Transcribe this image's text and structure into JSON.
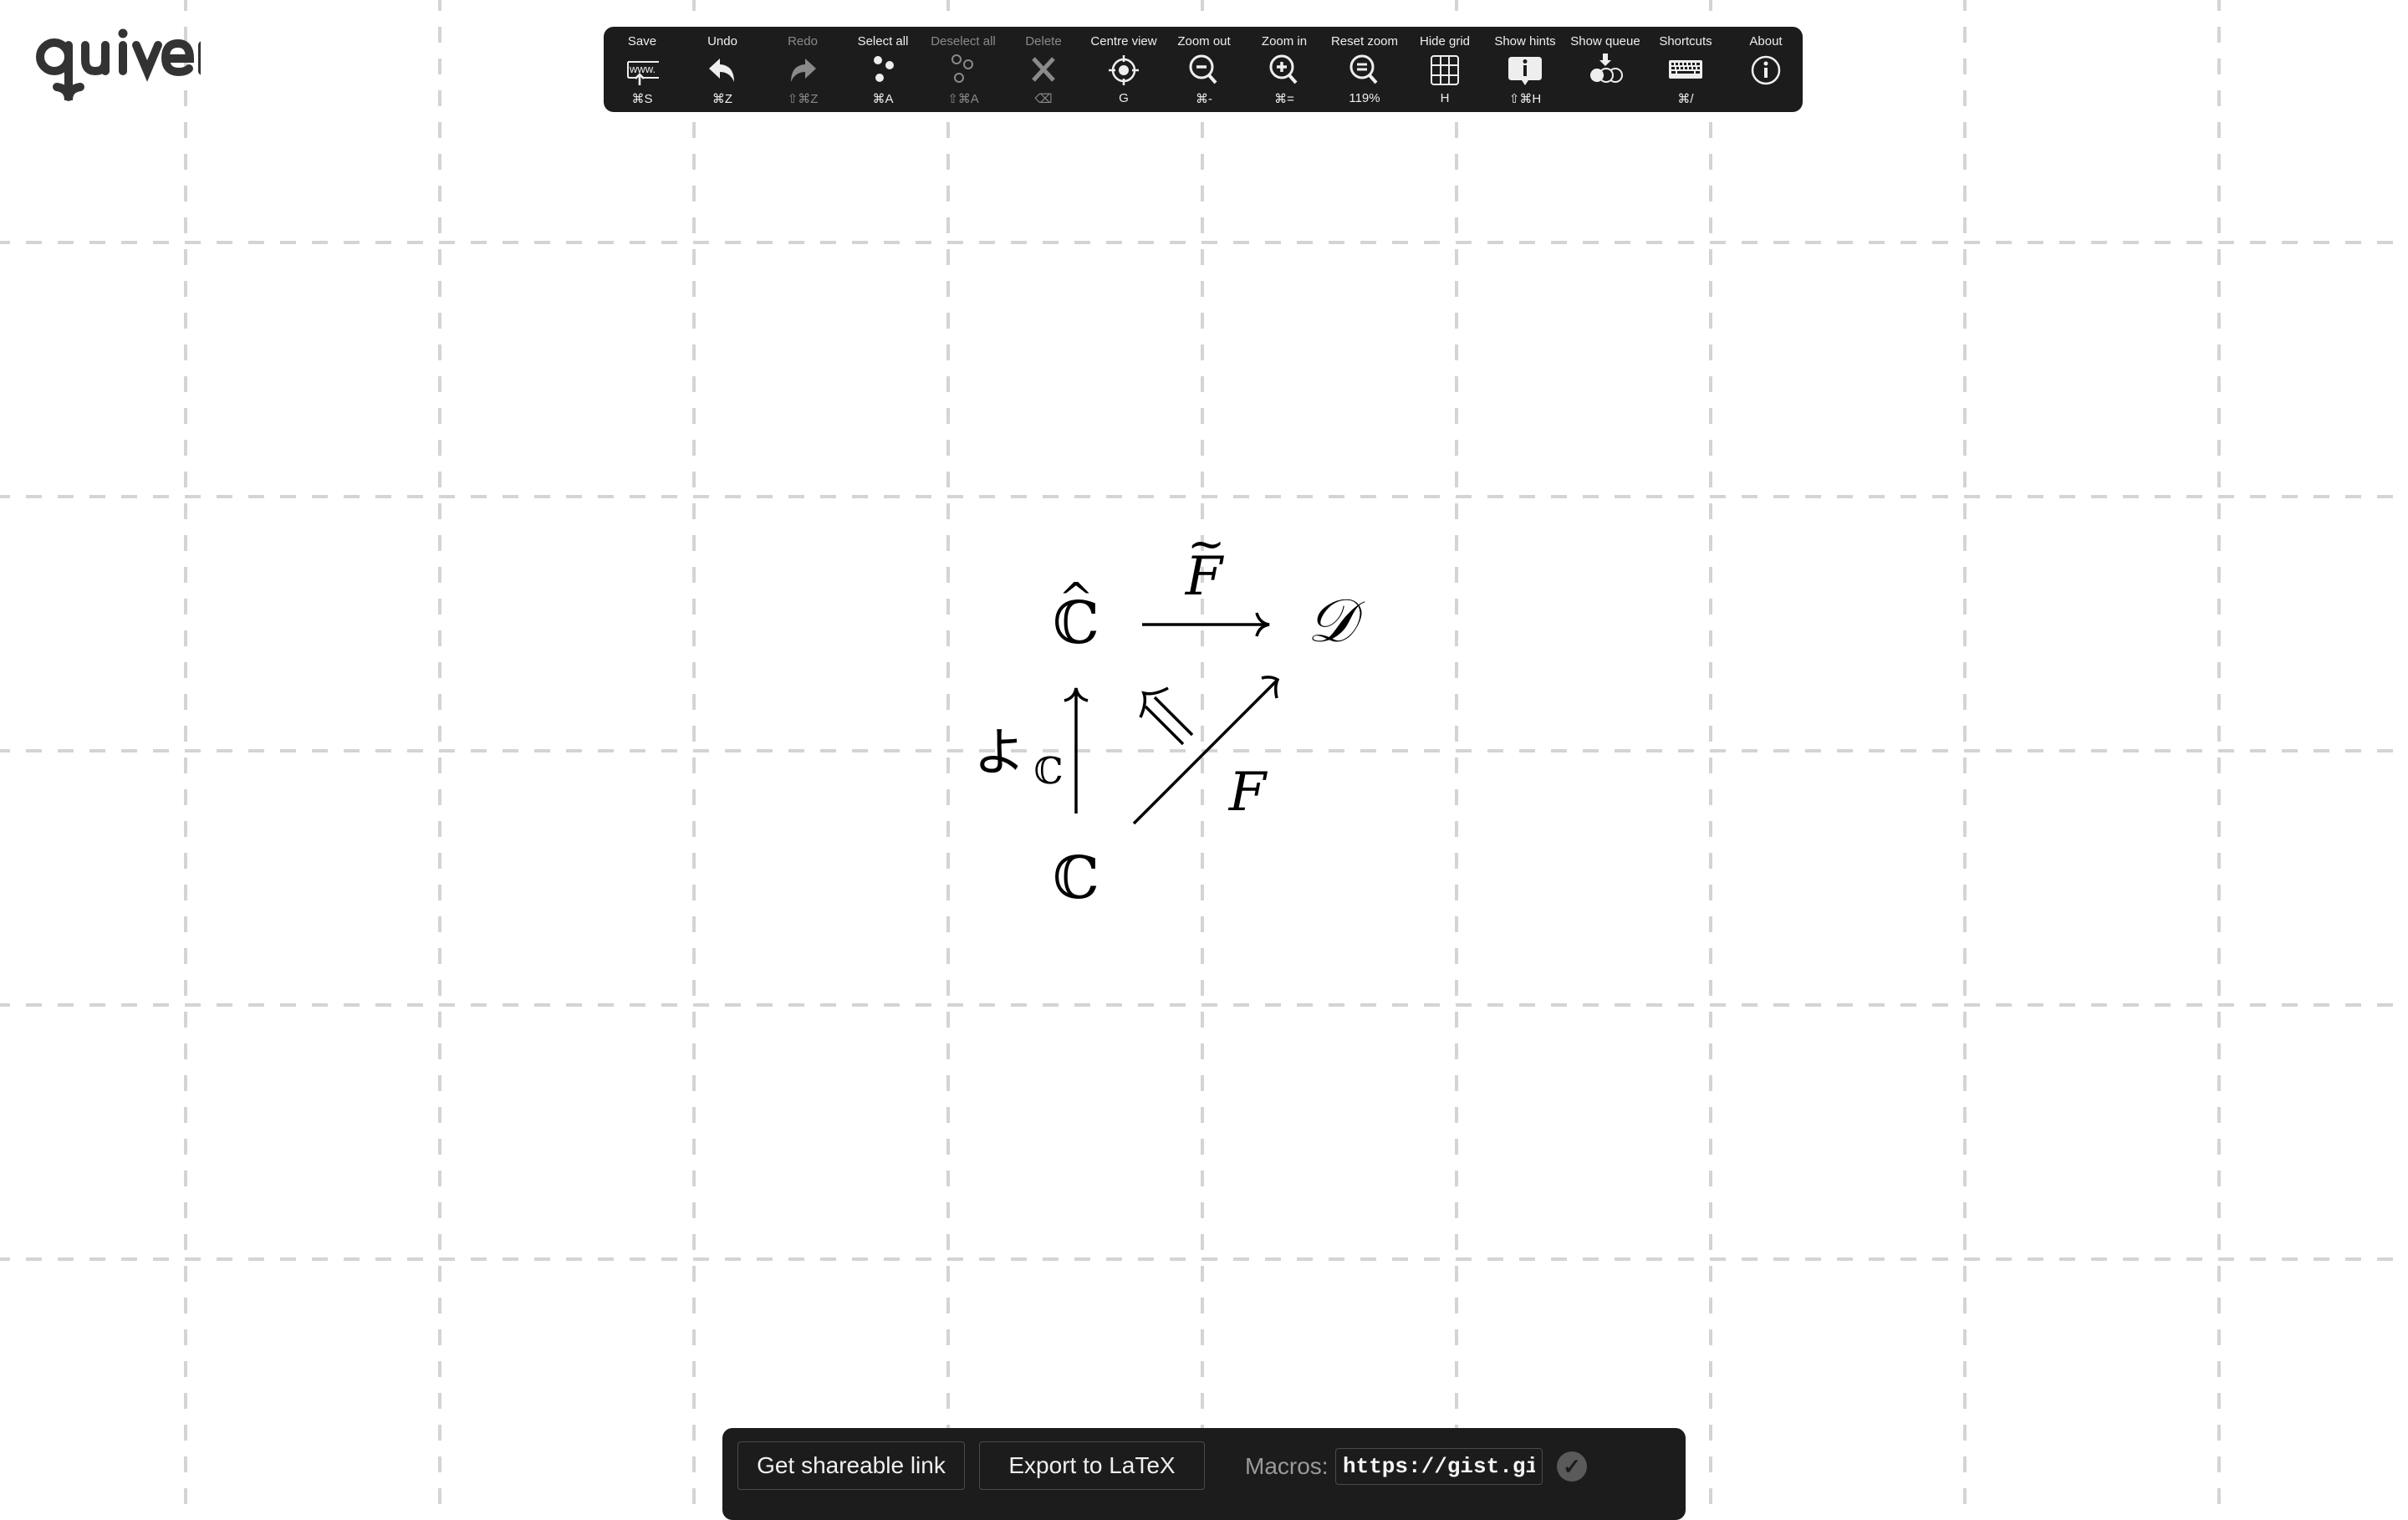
{
  "app": {
    "logo_text": "quiver"
  },
  "toolbar": {
    "items": [
      {
        "label": "Save",
        "shortcut": "⌘S",
        "icon": "save-url-icon",
        "enabled": true
      },
      {
        "label": "Undo",
        "shortcut": "⌘Z",
        "icon": "undo-icon",
        "enabled": true
      },
      {
        "label": "Redo",
        "shortcut": "⇧⌘Z",
        "icon": "redo-icon",
        "enabled": false
      },
      {
        "label": "Select all",
        "shortcut": "⌘A",
        "icon": "select-all-icon",
        "enabled": true
      },
      {
        "label": "Deselect all",
        "shortcut": "⇧⌘A",
        "icon": "deselect-all-icon",
        "enabled": false
      },
      {
        "label": "Delete",
        "shortcut": "⌫",
        "icon": "delete-icon",
        "enabled": false
      },
      {
        "label": "Centre view",
        "shortcut": "G",
        "icon": "centre-view-icon",
        "enabled": true
      },
      {
        "label": "Zoom out",
        "shortcut": "⌘-",
        "icon": "zoom-out-icon",
        "enabled": true
      },
      {
        "label": "Zoom in",
        "shortcut": "⌘=",
        "icon": "zoom-in-icon",
        "enabled": true
      },
      {
        "label": "Reset zoom",
        "shortcut": "119%",
        "icon": "reset-zoom-icon",
        "enabled": true
      },
      {
        "label": "Hide grid",
        "shortcut": "H",
        "icon": "grid-icon",
        "enabled": true
      },
      {
        "label": "Show hints",
        "shortcut": "⇧⌘H",
        "icon": "hints-icon",
        "enabled": true
      },
      {
        "label": "Show queue",
        "shortcut": "",
        "icon": "queue-icon",
        "enabled": true
      },
      {
        "label": "Shortcuts",
        "shortcut": "⌘/",
        "icon": "keyboard-icon",
        "enabled": true
      },
      {
        "label": "About",
        "shortcut": "",
        "icon": "info-icon",
        "enabled": true
      }
    ],
    "save_icon_text": "www."
  },
  "zoom_level": "119%",
  "diagram": {
    "nodes": [
      {
        "id": "C-hat",
        "text": "ℂ",
        "accent": "^"
      },
      {
        "id": "D",
        "text": "𝒟"
      },
      {
        "id": "C",
        "text": "ℂ"
      }
    ],
    "arrows": [
      {
        "from": "C-hat",
        "to": "D",
        "label": "F",
        "label_accent": "~",
        "style": "single"
      },
      {
        "from": "C",
        "to": "C-hat",
        "label": "よ",
        "label_subscript": "ℂ",
        "style": "single"
      },
      {
        "from": "C",
        "to": "D",
        "label": "F",
        "style": "single"
      },
      {
        "from": "arrow-F",
        "to": "arrow-Ftilde",
        "label": "",
        "style": "double (2-cell)"
      }
    ]
  },
  "bottombar": {
    "share_label": "Get shareable link",
    "export_label": "Export to LaTeX",
    "macros_label": "Macros:",
    "macros_value": "https://gist.githubusercontent.com",
    "check_glyph": "✓"
  }
}
